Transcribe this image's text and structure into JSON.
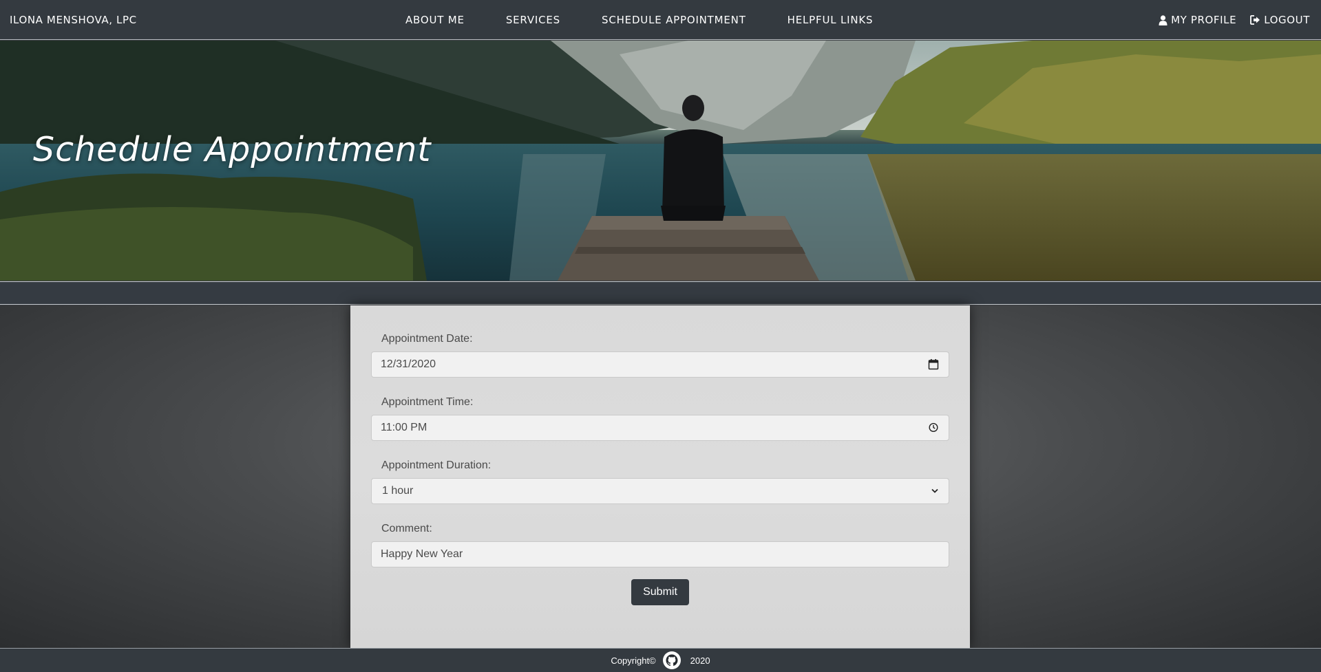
{
  "navbar": {
    "brand": "ILONA MENSHOVA, LPC",
    "links": [
      "ABOUT ME",
      "SERVICES",
      "SCHEDULE APPOINTMENT",
      "HELPFUL LINKS"
    ],
    "profile_label": "MY PROFILE",
    "logout_label": "LOGOUT"
  },
  "hero": {
    "title": "Schedule Appointment"
  },
  "form": {
    "date_label": "Appointment Date:",
    "date_value": "12/31/2020",
    "time_label": "Appointment Time:",
    "time_value": "11:00 PM",
    "duration_label": "Appointment Duration:",
    "duration_value": "1 hour",
    "comment_label": "Comment:",
    "comment_value": "Happy New Year",
    "submit_label": "Submit"
  },
  "footer": {
    "copyright": "Copyright©",
    "year": "2020"
  },
  "icons": {
    "profile": "user-icon",
    "logout": "sign-out-icon",
    "date": "calendar-icon",
    "time": "clock-icon",
    "duration": "chevron-down-icon",
    "footer": "github-icon"
  },
  "colors": {
    "navbar": "#343a40",
    "panel": "#d9d9d9",
    "button": "#343a40"
  }
}
